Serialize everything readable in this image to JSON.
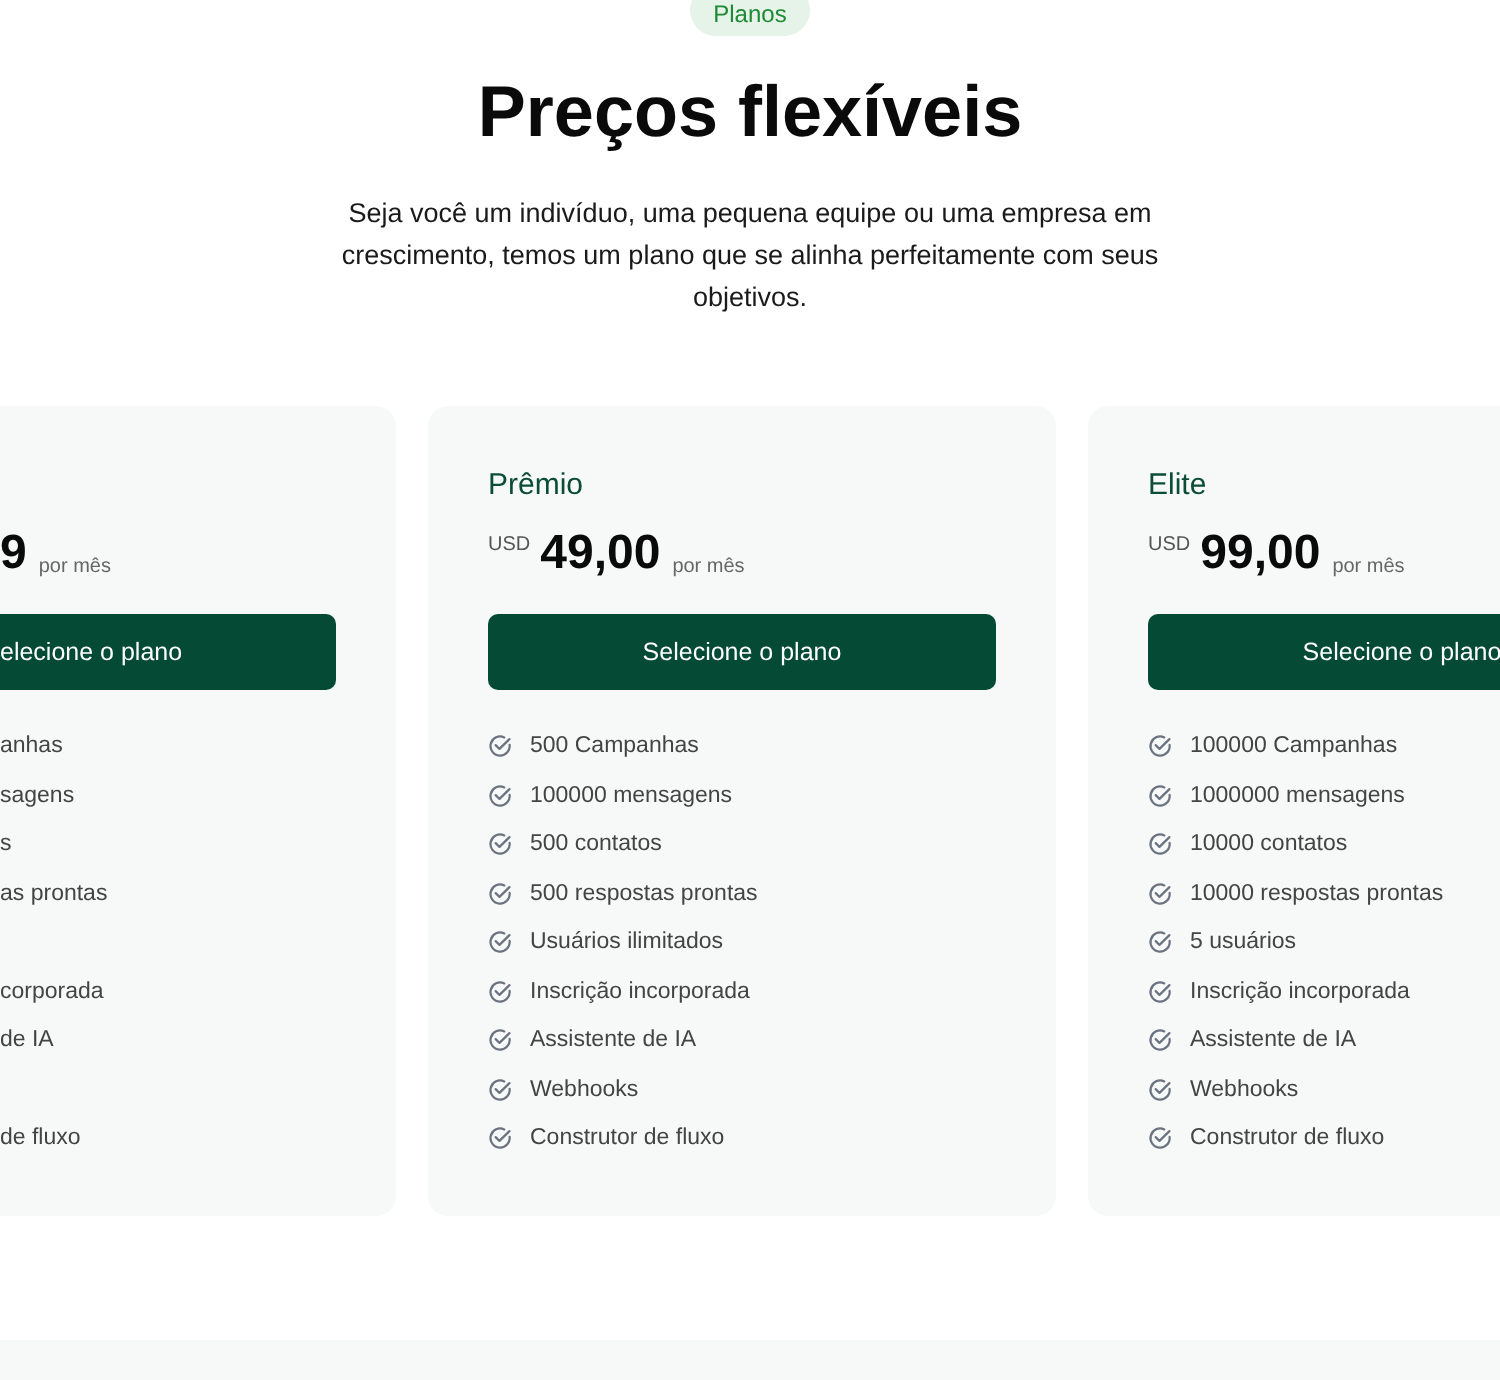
{
  "badge": "Planos",
  "title": "Preços flexíveis",
  "subtitle": "Seja você um indivíduo, uma pequena equipe ou uma empresa em crescimento, temos um plano que se alinha perfeitamente com seus objetivos.",
  "plans": [
    {
      "kind": "cut_left",
      "price": "9",
      "period": "por mês",
      "button": "elecione o plano",
      "features": [
        {
          "text": "anhas",
          "gap_before": false
        },
        {
          "text": "sagens",
          "gap_before": false
        },
        {
          "text": "s",
          "gap_before": false
        },
        {
          "text": "as prontas",
          "gap_before": false
        },
        {
          "text": "corporada",
          "gap_before": true
        },
        {
          "text": "de IA",
          "gap_before": false
        },
        {
          "text": "de fluxo",
          "gap_before": true
        }
      ]
    },
    {
      "kind": "full",
      "name": "Prêmio",
      "currency": "USD",
      "price": "49,00",
      "period": "por mês",
      "button": "Selecione o plano",
      "features": [
        {
          "text": "500 Campanhas",
          "gap_before": false
        },
        {
          "text": "100000 mensagens",
          "gap_before": false
        },
        {
          "text": "500 contatos",
          "gap_before": false
        },
        {
          "text": "500 respostas prontas",
          "gap_before": false
        },
        {
          "text": "Usuários ilimitados",
          "gap_before": false
        },
        {
          "text": "Inscrição incorporada",
          "gap_before": false
        },
        {
          "text": "Assistente de IA",
          "gap_before": false
        },
        {
          "text": "Webhooks",
          "gap_before": false
        },
        {
          "text": "Construtor de fluxo",
          "gap_before": false
        }
      ]
    },
    {
      "kind": "full",
      "name": "Elite",
      "currency": "USD",
      "price": "99,00",
      "period": "por mês",
      "button": "Selecione o plano",
      "features": [
        {
          "text": "100000 Campanhas",
          "gap_before": false
        },
        {
          "text": "1000000 mensagens",
          "gap_before": false
        },
        {
          "text": "10000 contatos",
          "gap_before": false
        },
        {
          "text": "10000 respostas prontas",
          "gap_before": false
        },
        {
          "text": "5 usuários",
          "gap_before": false
        },
        {
          "text": "Inscrição incorporada",
          "gap_before": false
        },
        {
          "text": "Assistente de IA",
          "gap_before": false
        },
        {
          "text": "Webhooks",
          "gap_before": false
        },
        {
          "text": "Construtor de fluxo",
          "gap_before": false
        }
      ]
    }
  ]
}
